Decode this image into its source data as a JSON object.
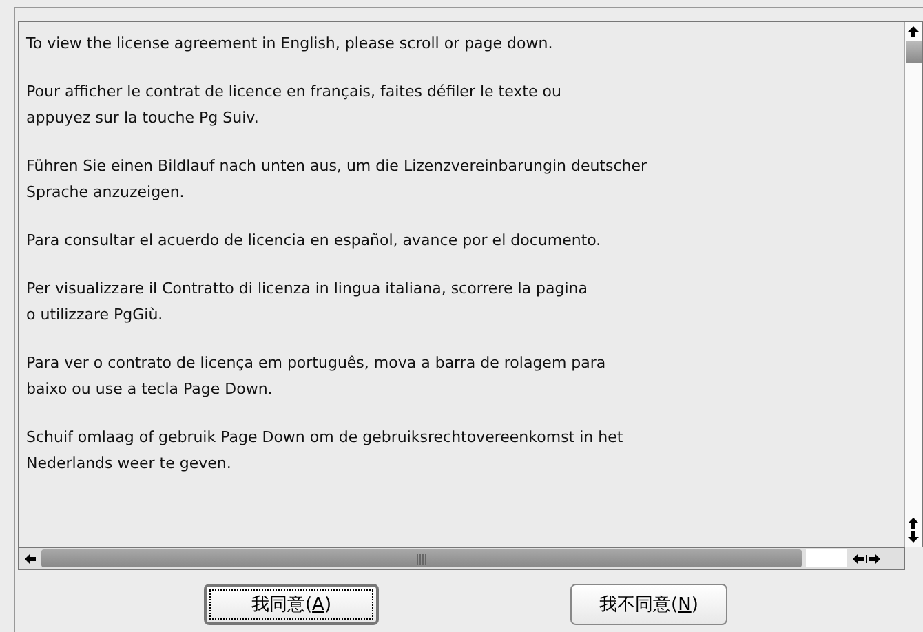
{
  "license_text": {
    "paragraphs": [
      {
        "lines": [
          "To view the license agreement in English, please scroll or page down."
        ]
      },
      {
        "lines": [
          "Pour afficher le contrat de licence en français, faites défiler le texte ou",
          "appuyez sur la touche Pg Suiv."
        ]
      },
      {
        "lines": [
          "Führen Sie einen Bildlauf nach unten aus, um die Lizenzvereinbarungin deutscher",
          "Sprache anzuzeigen."
        ]
      },
      {
        "lines": [
          "Para consultar el acuerdo de licencia en español, avance por el documento."
        ]
      },
      {
        "lines": [
          "Per visualizzare il Contratto di licenza in lingua italiana, scorrere la pagina",
          "o utilizzare PgGiù."
        ]
      },
      {
        "lines": [
          "Para ver o contrato de licença em português, mova a barra de rolagem para",
          "baixo ou use a tecla Page Down."
        ]
      },
      {
        "lines": [
          "Schuif omlaag of gebruik Page Down om de gebruiksrechtovereenkomst in het",
          "Nederlands weer te geven."
        ]
      }
    ]
  },
  "buttons": [
    {
      "before": "我同意(",
      "mnemonic": "A",
      "after": ")",
      "focused": true
    },
    {
      "before": "我不同意(",
      "mnemonic": "N",
      "after": ")",
      "focused": false
    }
  ]
}
